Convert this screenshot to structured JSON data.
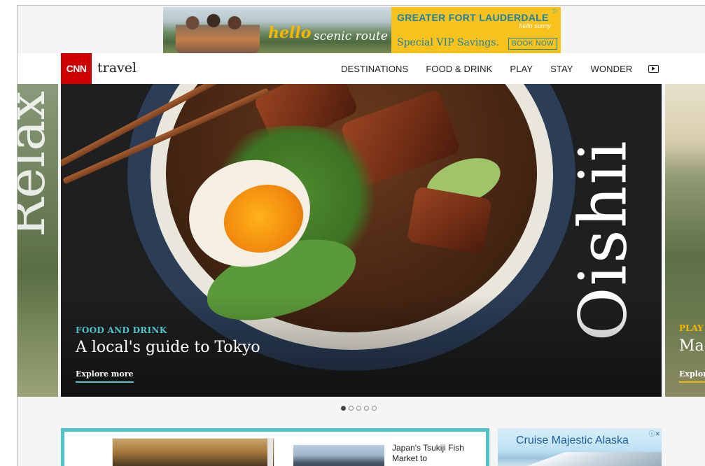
{
  "ad_top": {
    "headline": "GREATER FORT LAUDERDALE",
    "tagline_small": "hello sunny",
    "hello": "hello",
    "scenic": "scenic route",
    "offer": "Special VIP Savings.",
    "cta": "BOOK NOW",
    "adchoices_icon": "adchoices-triangle-icon",
    "colors": {
      "accent": "#f8c21c",
      "text": "#1d7fa3"
    }
  },
  "header": {
    "logo": "CNN",
    "section": "travel",
    "nav": [
      "DESTINATIONS",
      "FOOD & DRINK",
      "PLAY",
      "STAY",
      "WONDER"
    ],
    "video_icon": "video-play-icon"
  },
  "carousel": {
    "left_peek_text": "Relax",
    "hero": {
      "overlay_text": "Oishii",
      "category": "FOOD AND DRINK",
      "title": "A local's guide to Tokyo",
      "cta": "Explore more"
    },
    "right_peek": {
      "category": "PLAY",
      "title": "Ma",
      "cta": "Explore"
    },
    "dots": 5,
    "active_dot": 1
  },
  "bottom": {
    "story_teaser": "Japan's Tsukiji Fish Market to",
    "cruise_ad": "Cruise Majestic Alaska",
    "cruise_ad_choice": "ⓘ✕",
    "colors": {
      "panel_border": "#4fc3c8"
    }
  }
}
